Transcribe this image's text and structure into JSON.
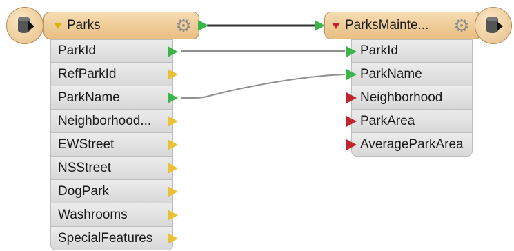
{
  "source": {
    "title": "Parks",
    "attributes": [
      {
        "name": "ParkId",
        "connected": true
      },
      {
        "name": "RefParkId",
        "connected": false
      },
      {
        "name": "ParkName",
        "connected": true
      },
      {
        "name": "Neighborhood...",
        "connected": false
      },
      {
        "name": "EWStreet",
        "connected": false
      },
      {
        "name": "NSStreet",
        "connected": false
      },
      {
        "name": "DogPark",
        "connected": false
      },
      {
        "name": "Washrooms",
        "connected": false
      },
      {
        "name": "SpecialFeatures",
        "connected": false
      }
    ]
  },
  "destination": {
    "title": "ParksMainte...",
    "attributes": [
      {
        "name": "ParkId",
        "connected": true
      },
      {
        "name": "ParkName",
        "connected": true
      },
      {
        "name": "Neighborhood",
        "connected": false
      },
      {
        "name": "ParkArea",
        "connected": false
      },
      {
        "name": "AverageParkArea",
        "connected": false
      }
    ]
  },
  "colors": {
    "header": "#e8be82",
    "port_connected": "#3bb54a",
    "port_unconnected_out": "#e8c234",
    "port_unconnected_in": "#c0262b",
    "wire_main": "#333333",
    "wire_attr": "#909090"
  },
  "icons": {
    "source_icon": "database-reader-icon",
    "destination_icon": "database-writer-icon",
    "settings_icon": "gear-icon"
  }
}
